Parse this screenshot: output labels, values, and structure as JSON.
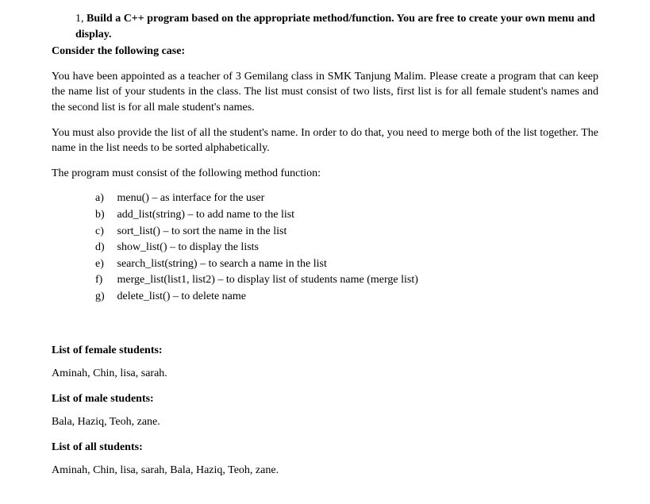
{
  "question": {
    "number": "1,",
    "title": "Build a C++ program based on the appropriate method/function. You are free to create your own menu and display."
  },
  "consider": "Consider the following case:",
  "paragraphs": [
    "You have been appointed as a teacher of 3 Gemilang class in SMK Tanjung Malim. Please create a program that can keep the name list of your students in the class. The list must consist of two lists, first list is for all female student's names and the second list is for all male student's names.",
    "You must also provide the list of all the student's name. In order to do that, you need to merge both of the list together. The name in the list needs to be sorted alphabetically.",
    "The program must consist of the following method function:"
  ],
  "functions": [
    {
      "marker": "a)",
      "text": "menu() – as interface for the user"
    },
    {
      "marker": "b)",
      "text": "add_list(string) – to add name to the list"
    },
    {
      "marker": "c)",
      "text": "sort_list() – to sort the name in the list"
    },
    {
      "marker": "d)",
      "text": "show_list() – to display the lists"
    },
    {
      "marker": "e)",
      "text": "search_list(string) – to search a name in the list"
    },
    {
      "marker": "f)",
      "text": "merge_list(list1, list2) – to display list of students name (merge list)"
    },
    {
      "marker": "g)",
      "text": "delete_list() – to delete name"
    }
  ],
  "sections": [
    {
      "heading": "List of female students:",
      "content": "Aminah, Chin, lisa, sarah."
    },
    {
      "heading": "List of male students:",
      "content": "Bala, Haziq, Teoh, zane."
    },
    {
      "heading": "List of all students:",
      "content": "Aminah, Chin, lisa, sarah, Bala, Haziq, Teoh, zane."
    }
  ]
}
